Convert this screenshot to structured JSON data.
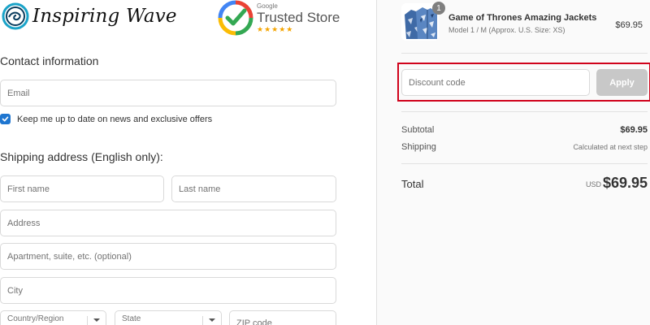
{
  "brand": {
    "name": "Inspiring Wave",
    "logo_icon": "wave-circle-logo"
  },
  "trust_badge": {
    "google_label": "Google",
    "title": "Trusted Store",
    "stars": "★★★★★",
    "icon": "checkmark-badge-icon"
  },
  "contact": {
    "heading": "Contact information",
    "email_placeholder": "Email",
    "newsletter_label": "Keep me up to date on news and exclusive offers",
    "newsletter_checked": true
  },
  "shipping": {
    "heading": "Shipping address (English only):",
    "first_name_placeholder": "First name",
    "last_name_placeholder": "Last name",
    "address_placeholder": "Address",
    "apartment_placeholder": "Apartment, suite, etc. (optional)",
    "city_placeholder": "City",
    "country_label": "Country/Region",
    "state_label": "State",
    "zip_placeholder": "ZIP code"
  },
  "cart": {
    "item": {
      "quantity": "1",
      "title": "Game of Thrones Amazing Jackets",
      "variant": "Model 1 / M (Approx. U.S. Size: XS)",
      "price": "$69.95",
      "thumbnail_icon": "jacket-thumbnail"
    },
    "discount": {
      "placeholder": "Discount code",
      "apply_label": "Apply",
      "highlight_color": "#d0021b"
    },
    "subtotal_label": "Subtotal",
    "subtotal_value": "$69.95",
    "shipping_label": "Shipping",
    "shipping_value": "Calculated at next step",
    "total_label": "Total",
    "total_currency": "USD",
    "total_value": "$69.95"
  },
  "colors": {
    "accent": "#1f76d0",
    "apply_disabled": "#c8c8c8",
    "sidebar_bg": "#fafafa"
  }
}
